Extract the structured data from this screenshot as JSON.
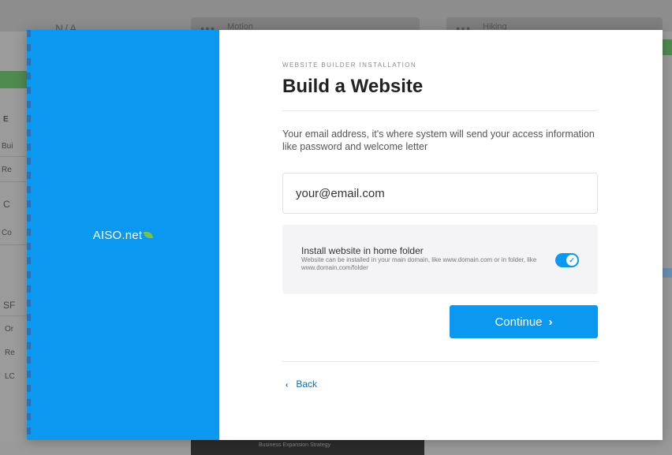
{
  "background": {
    "left_title": "N/A",
    "left_labels": [
      "E",
      "Bui",
      "Re",
      "C",
      "Co",
      "SF",
      "Or",
      "Re",
      "LC"
    ],
    "cards": [
      {
        "dots": "●●●",
        "title": "Motion"
      },
      {
        "dots": "●●●",
        "title": "Hiking"
      }
    ],
    "bottom_card_text": "Business Expansion Strategy"
  },
  "brand": {
    "logo_text": "AISO.net",
    "accent_color": "#0b98f1",
    "leaf_color": "#79c24a"
  },
  "form": {
    "eyebrow": "WEBSITE BUILDER INSTALLATION",
    "title": "Build a Website",
    "description": "Your email address, it's where system will send your access information like password and welcome letter",
    "email": {
      "value": "",
      "placeholder": "your@email.com"
    },
    "option": {
      "title": "Install website in home folder",
      "description": "Website can be installed in your main domain, like www.domain.com or in folder, like www.domain.com/folder",
      "enabled": true,
      "toggle_icon": "check-icon"
    },
    "continue_label": "Continue",
    "back_label": "Back"
  }
}
